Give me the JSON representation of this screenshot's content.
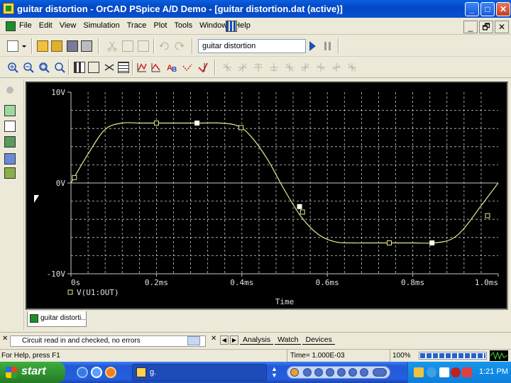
{
  "window": {
    "title": "guitar distortion - OrCAD PSpice A/D Demo  - [guitar distortion.dat (active)]",
    "minimize": "_",
    "maximize": "□",
    "close": "✕"
  },
  "menu": {
    "items": [
      "File",
      "Edit",
      "View",
      "Simulation",
      "Trace",
      "Plot",
      "Tools",
      "Window",
      "Help"
    ],
    "mdi_minimize": "_",
    "mdi_restore": "🗗",
    "mdi_close": "✕"
  },
  "toolbar": {
    "profile": "guitar distortion"
  },
  "chart_data": {
    "type": "line",
    "xlabel": "Time",
    "x_ticks": [
      "0s",
      "0.2ms",
      "0.4ms",
      "0.6ms",
      "0.8ms",
      "1.0ms"
    ],
    "y_ticks": [
      "10V",
      "0V",
      "-10V"
    ],
    "xlim": [
      0,
      1.0
    ],
    "ylim": [
      -10,
      10
    ],
    "x_unit": "ms",
    "y_unit": "V",
    "grid": true,
    "series": [
      {
        "name": "V(U1:OUT)",
        "color": "#e8e890",
        "x": [
          0,
          0.04,
          0.08,
          0.12,
          0.16,
          0.2,
          0.25,
          0.3,
          0.35,
          0.39,
          0.42,
          0.46,
          0.5,
          0.54,
          0.58,
          0.62,
          0.66,
          0.7,
          0.75,
          0.8,
          0.85,
          0.89,
          0.92,
          0.96,
          1.0
        ],
        "values": [
          0,
          3.2,
          5.9,
          6.6,
          6.6,
          6.6,
          6.6,
          6.6,
          6.6,
          6.3,
          5.2,
          2.6,
          -0.8,
          -3.8,
          -5.7,
          -6.5,
          -6.6,
          -6.6,
          -6.6,
          -6.6,
          -6.6,
          -6.2,
          -5.0,
          -2.5,
          0
        ],
        "markers": [
          {
            "x": 0.008,
            "y": 0.6,
            "style": "hollow"
          },
          {
            "x": 0.2,
            "y": 6.6,
            "style": "hollow"
          },
          {
            "x": 0.295,
            "y": 6.6,
            "style": "filled"
          },
          {
            "x": 0.398,
            "y": 6.1,
            "style": "hollow"
          },
          {
            "x": 0.535,
            "y": -2.6,
            "style": "filled"
          },
          {
            "x": 0.542,
            "y": -3.2,
            "style": "hollow"
          },
          {
            "x": 0.745,
            "y": -6.6,
            "style": "hollow"
          },
          {
            "x": 0.845,
            "y": -6.6,
            "style": "filled"
          },
          {
            "x": 0.975,
            "y": -3.6,
            "style": "hollow"
          }
        ]
      }
    ]
  },
  "doc_tab": "guitar distorti...",
  "output": {
    "message": "Circuit read in and checked, no errors",
    "tabs": [
      "Analysis",
      "Watch",
      "Devices"
    ]
  },
  "status": {
    "help": "For Help, press F1",
    "time": "Time= 1.000E-03",
    "percent": "100%",
    "progress": 1.0
  },
  "taskbar": {
    "start": "start",
    "task": "g.",
    "clock": "1:21 PM"
  },
  "colors": {
    "plot_bg": "#000000",
    "grid": "#c8c8c8",
    "trace": "#e8e890",
    "axis_text": "#e0e0e0"
  }
}
